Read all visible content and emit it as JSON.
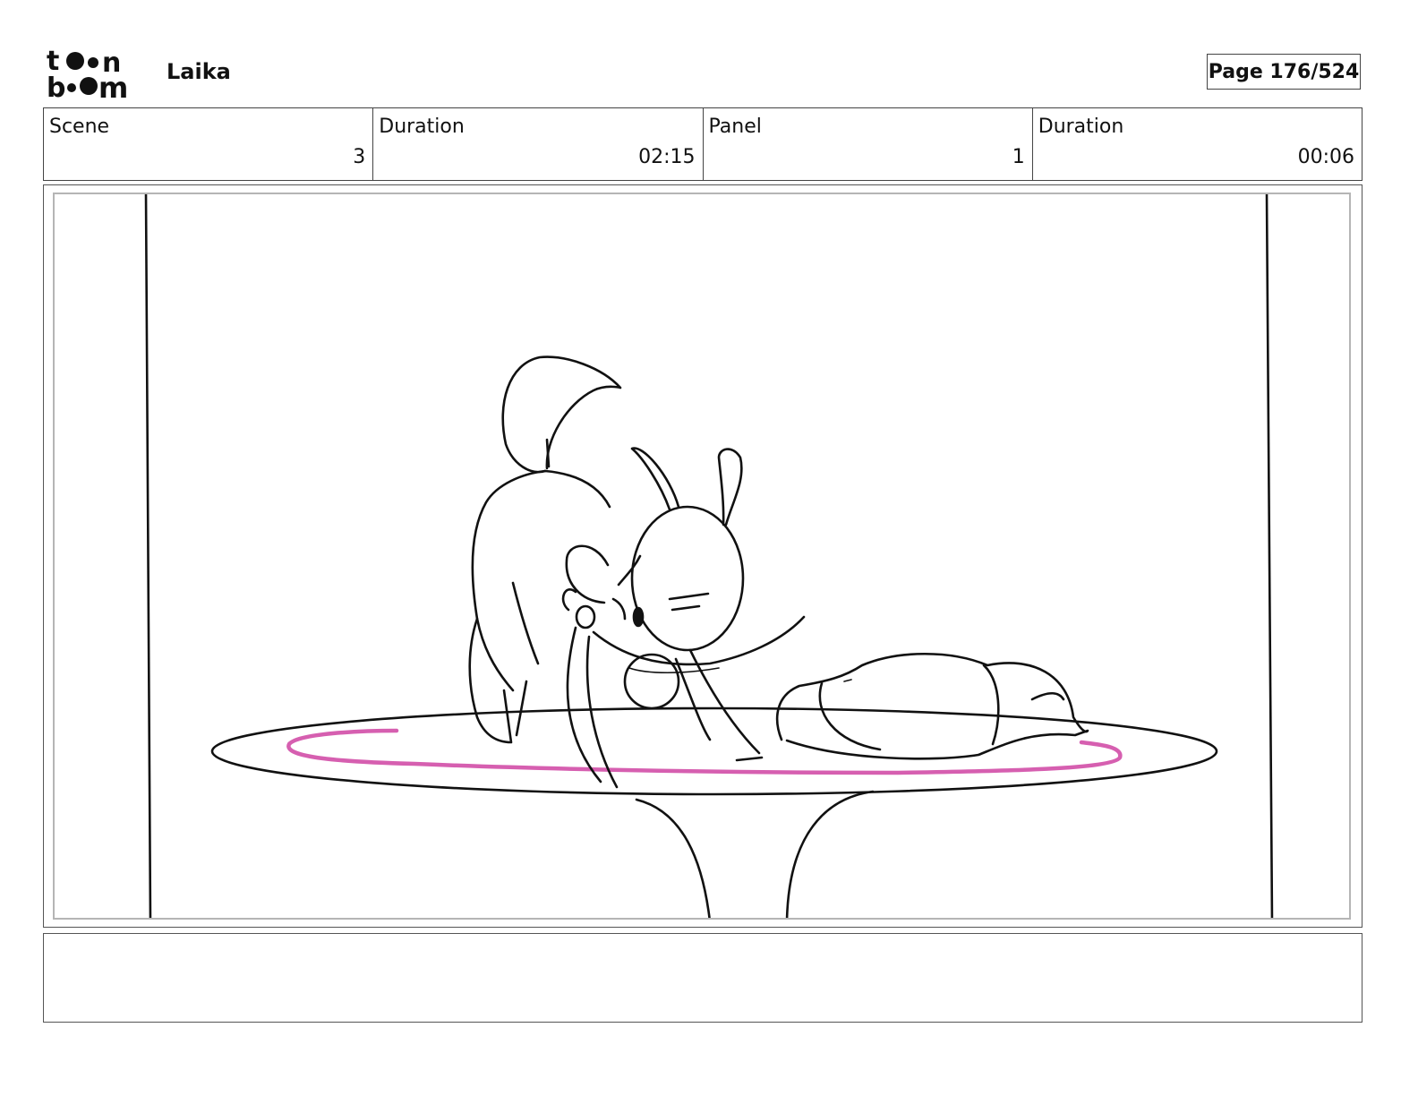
{
  "header": {
    "logo_text": "toonboom",
    "project_title": "Laika",
    "page_counter": "Page 176/524"
  },
  "info_bar": {
    "scene_label": "Scene",
    "scene_value": "3",
    "scene_duration_label": "Duration",
    "scene_duration_value": "02:15",
    "panel_label": "Panel",
    "panel_value": "1",
    "panel_duration_label": "Duration",
    "panel_duration_value": "00:06"
  },
  "panel": {
    "sketch_description_icon": "storyboard-sketch",
    "accent_color": "#d65fb0"
  },
  "notes": {
    "text": ""
  }
}
